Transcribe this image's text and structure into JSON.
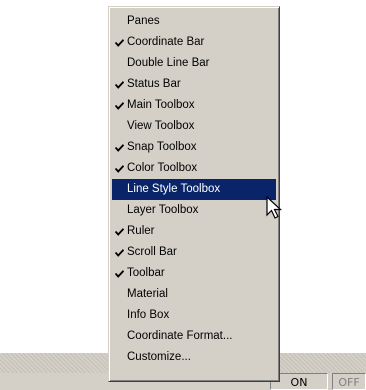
{
  "menu": {
    "items": [
      {
        "label": "Panes",
        "checked": false,
        "highlighted": false
      },
      {
        "label": "Coordinate Bar",
        "checked": true,
        "highlighted": false
      },
      {
        "label": "Double Line Bar",
        "checked": false,
        "highlighted": false
      },
      {
        "label": "Status Bar",
        "checked": true,
        "highlighted": false
      },
      {
        "label": "Main Toolbox",
        "checked": true,
        "highlighted": false
      },
      {
        "label": "View Toolbox",
        "checked": false,
        "highlighted": false
      },
      {
        "label": "Snap Toolbox",
        "checked": true,
        "highlighted": false
      },
      {
        "label": "Color Toolbox",
        "checked": true,
        "highlighted": false
      },
      {
        "label": "Line Style Toolbox",
        "checked": false,
        "highlighted": true
      },
      {
        "label": "Layer Toolbox",
        "checked": false,
        "highlighted": false
      },
      {
        "label": "Ruler",
        "checked": true,
        "highlighted": false
      },
      {
        "label": "Scroll Bar",
        "checked": true,
        "highlighted": false
      },
      {
        "label": "Toolbar",
        "checked": true,
        "highlighted": false
      },
      {
        "label": "Material",
        "checked": false,
        "highlighted": false
      },
      {
        "label": "Info Box",
        "checked": false,
        "highlighted": false
      },
      {
        "label": "Coordinate Format...",
        "checked": false,
        "highlighted": false
      },
      {
        "label": "Customize...",
        "checked": false,
        "highlighted": false
      }
    ]
  },
  "status_bar": {
    "on_label": "ON",
    "off_label": "OFF"
  },
  "colors": {
    "menu_bg": "#d4d0c8",
    "highlight_bg": "#0a246a",
    "highlight_text": "#ffffff",
    "text": "#000000"
  },
  "icons": {
    "check": "checkmark-icon",
    "cursor": "arrow-cursor-icon"
  }
}
